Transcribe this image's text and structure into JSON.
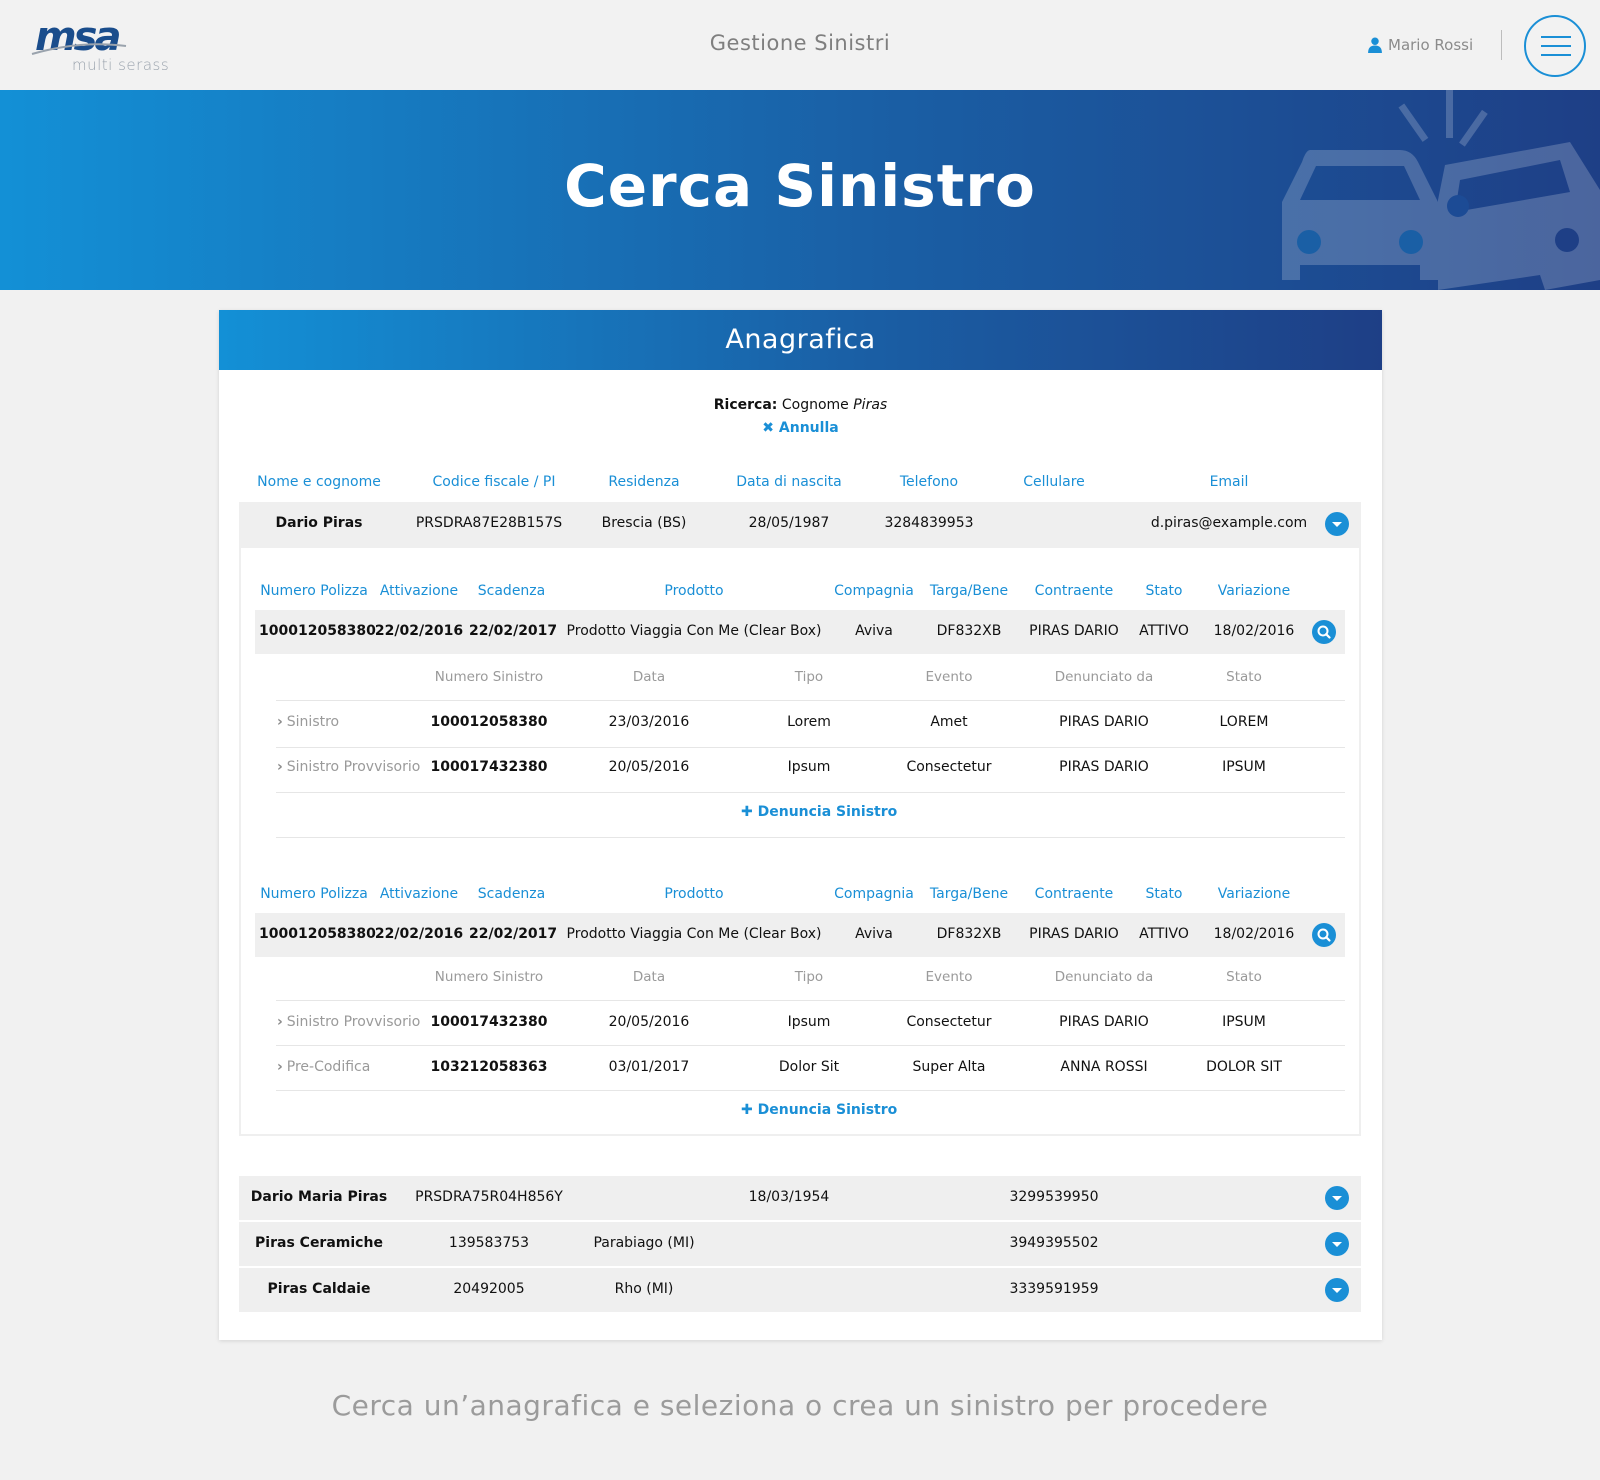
{
  "brand": {
    "mark": "msa",
    "sub": "multi serass"
  },
  "header": {
    "title": "Gestione Sinistri",
    "user": "Mario Rossi"
  },
  "hero": {
    "title": "Cerca Sinistro"
  },
  "card": {
    "title": "Anagrafica"
  },
  "search": {
    "label": "Ricerca:",
    "field": "Cognome",
    "value": "Piras",
    "cancel": "Annulla"
  },
  "columns": [
    "Nome e cognome",
    "Codice fiscale / PI",
    "Residenza",
    "Data di nascita",
    "Telefono",
    "Cellulare",
    "Email"
  ],
  "main_person": {
    "name": "Dario Piras",
    "cf": "PRSDRA87E28B157S",
    "residenza": "Brescia (BS)",
    "nascita": "28/05/1987",
    "telefono": "3284839953",
    "cellulare": "",
    "email": "d.piras@example.com"
  },
  "policy_columns": [
    "Numero Polizza",
    "Attivazione",
    "Scadenza",
    "Prodotto",
    "Compagnia",
    "Targa/Bene",
    "Contraente",
    "Stato",
    "Variazione"
  ],
  "claim_columns": [
    "Numero Sinistro",
    "Data",
    "Tipo",
    "Evento",
    "Denunciato da",
    "Stato"
  ],
  "policies": [
    {
      "numero": "100012058380",
      "attivazione": "22/02/2016",
      "scadenza": "22/02/2017",
      "prodotto": "Prodotto Viaggia Con Me (Clear Box)",
      "compagnia": "Aviva",
      "targa": "DF832XB",
      "contraente": "PIRAS DARIO",
      "stato": "ATTIVO",
      "variazione": "18/02/2016",
      "claims": [
        {
          "tipo_label": "Sinistro",
          "numero": "100012058380",
          "data": "23/03/2016",
          "tipo": "Lorem",
          "evento": "Amet",
          "denunciato": "PIRAS DARIO",
          "stato": "LOREM"
        },
        {
          "tipo_label": "Sinistro Provvisorio",
          "numero": "100017432380",
          "data": "20/05/2016",
          "tipo": "Ipsum",
          "evento": "Consectetur",
          "denunciato": "PIRAS DARIO",
          "stato": "IPSUM"
        }
      ]
    },
    {
      "numero": "100012058380",
      "attivazione": "22/02/2016",
      "scadenza": "22/02/2017",
      "prodotto": "Prodotto Viaggia Con Me (Clear Box)",
      "compagnia": "Aviva",
      "targa": "DF832XB",
      "contraente": "PIRAS DARIO",
      "stato": "ATTIVO",
      "variazione": "18/02/2016",
      "claims": [
        {
          "tipo_label": "Sinistro Provvisorio",
          "numero": "100017432380",
          "data": "20/05/2016",
          "tipo": "Ipsum",
          "evento": "Consectetur",
          "denunciato": "PIRAS DARIO",
          "stato": "IPSUM"
        },
        {
          "tipo_label": "Pre-Codifica",
          "numero": "103212058363",
          "data": "03/01/2017",
          "tipo": "Dolor Sit",
          "evento": "Super Alta",
          "denunciato": "ANNA ROSSI",
          "stato": "DOLOR SIT"
        }
      ]
    }
  ],
  "denuncia_label": "Denuncia Sinistro",
  "other_people": [
    {
      "name": "Dario Maria Piras",
      "cf": "PRSDRA75R04H856Y",
      "residenza": "",
      "nascita": "18/03/1954",
      "telefono": "",
      "cellulare": "3299539950"
    },
    {
      "name": "Piras Ceramiche",
      "cf": "139583753",
      "residenza": "Parabiago (MI)",
      "nascita": "",
      "telefono": "",
      "cellulare": "3949395502"
    },
    {
      "name": "Piras Caldaie",
      "cf": "20492005",
      "residenza": "Rho (MI)",
      "nascita": "",
      "telefono": "",
      "cellulare": "3339591959"
    }
  ],
  "footer": {
    "text": "Cerca un’anagrafica e seleziona o crea un sinistro per procedere"
  },
  "colors": {
    "accent": "#1a8fd6",
    "gradient_start": "#1390d6",
    "gradient_end": "#1e3f86"
  }
}
